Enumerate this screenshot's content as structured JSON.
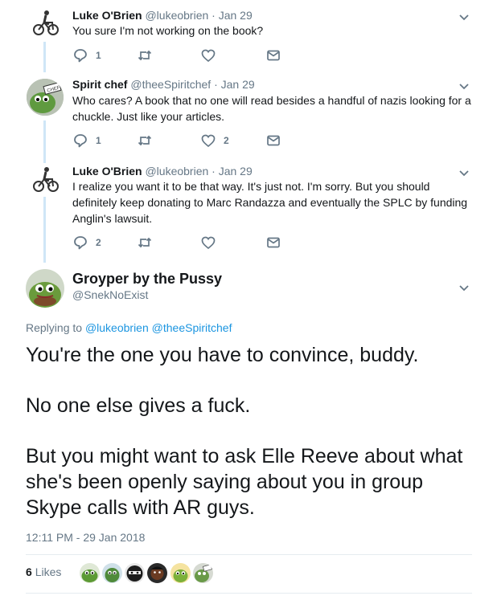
{
  "colors": {
    "accent": "#1b95e0",
    "text": "#14171a",
    "muted": "#657786",
    "thread_line": "#cfe6f7"
  },
  "replies": [
    {
      "name": "Luke O'Brien",
      "handle": "@lukeobrien",
      "date": "· Jan 29",
      "text": "You sure I'm not working on the book?",
      "avatar_icon": "cyclist-icon",
      "reply_count": "1",
      "retweet_count": "",
      "like_count": ""
    },
    {
      "name": "Spirit chef",
      "handle": "@theeSpiritchef",
      "date": "· Jan 29",
      "text": "Who cares? A book that no one will read besides a handful of nazis looking for a chuckle. Just like your articles.",
      "avatar_icon": "frog-avatar-icon",
      "reply_count": "1",
      "retweet_count": "",
      "like_count": "2"
    },
    {
      "name": "Luke O'Brien",
      "handle": "@lukeobrien",
      "date": "· Jan 29",
      "text": "I realize you want it to be that way. It's just not. I'm sorry. But you should definitely keep donating to Marc Randazza and eventually the SPLC by funding Anglin's lawsuit.",
      "avatar_icon": "cyclist-icon",
      "reply_count": "2",
      "retweet_count": "",
      "like_count": ""
    }
  ],
  "main_tweet": {
    "name": "Groyper by the Pussy",
    "handle": "@SnekNoExist",
    "replying_label": "Replying to",
    "replying_to": [
      "@lukeobrien",
      "@theeSpiritchef"
    ],
    "paragraphs": [
      "You're the one you have to convince, buddy.",
      "No one else gives a fuck.",
      "But you might want to ask Elle Reeve about what she's been openly saying about you in group Skype calls with AR guys."
    ],
    "timestamp": "12:11 PM - 29 Jan 2018",
    "likes_count": "6",
    "likes_label": "Likes",
    "likers": [
      "frog-avatar-icon",
      "frog-avatar-icon",
      "masked-avatar-icon",
      "dark-face-avatar-icon",
      "frog-avatar-icon",
      "frog-avatar-icon"
    ]
  }
}
